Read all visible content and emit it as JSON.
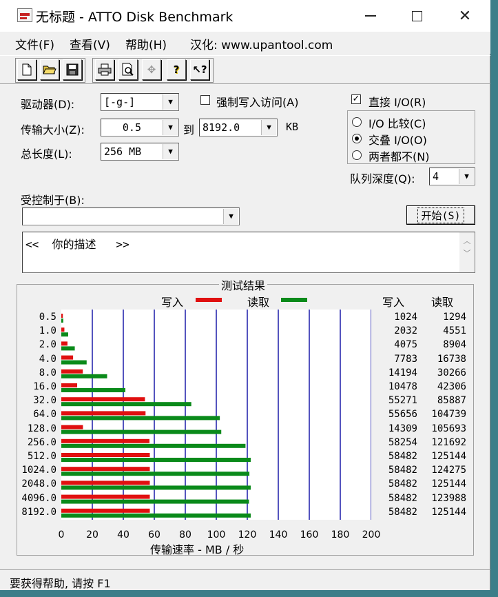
{
  "window": {
    "title": "无标题 - ATTO Disk Benchmark"
  },
  "menu": {
    "items": [
      "文件(F)",
      "查看(V)",
      "帮助(H)",
      "汉化: www.upantool.com"
    ]
  },
  "toolbar": {
    "icons": [
      "new-file-icon",
      "open-folder-icon",
      "save-icon",
      "print-icon",
      "print-preview-icon",
      "move-icon",
      "help-icon",
      "context-help-icon"
    ]
  },
  "form": {
    "drive_label": "驱动器(D):",
    "drive_value": "[-g-]",
    "transfer_label": "传输大小(Z):",
    "transfer_from": "0.5",
    "to_label": "到",
    "transfer_to": "8192.0",
    "kb_label": "KB",
    "total_label": "总长度(L):",
    "total_value": "256 MB",
    "force_write_label": "强制写入访问(A)",
    "direct_io_label": "直接 I/O(R)",
    "direct_io_checked": true,
    "io_compare_label": "I/O 比较(C)",
    "overlap_io_label": "交叠 I/O(O)",
    "neither_label": "两者都不(N)",
    "queue_label": "队列深度(Q):",
    "queue_value": "4",
    "controlled_label": "受控制于(B):",
    "controlled_value": "",
    "start_label": "开始(S)",
    "description": "<<  你的描述   >>"
  },
  "results": {
    "title": "测试结果",
    "write_legend": "写入",
    "read_legend": "读取",
    "write_col": "写入",
    "read_col": "读取",
    "write_color": "#e01010",
    "read_color": "#0a8a1a",
    "grid_color": "#1a1aa8"
  },
  "chart_data": {
    "type": "bar",
    "orientation": "horizontal",
    "categories": [
      "0.5",
      "1.0",
      "2.0",
      "4.0",
      "8.0",
      "16.0",
      "32.0",
      "64.0",
      "128.0",
      "256.0",
      "512.0",
      "1024.0",
      "2048.0",
      "4096.0",
      "8192.0"
    ],
    "series": [
      {
        "name": "写入",
        "values": [
          1024,
          2032,
          4075,
          7783,
          14194,
          10478,
          55271,
          55656,
          14309,
          58254,
          58482,
          58482,
          58482,
          58482,
          58482
        ]
      },
      {
        "name": "读取",
        "values": [
          1294,
          4551,
          8904,
          16738,
          30266,
          42306,
          85887,
          104739,
          105693,
          121692,
          125144,
          124275,
          125144,
          123988,
          125144
        ]
      }
    ],
    "xticks": [
      "0",
      "20",
      "40",
      "60",
      "80",
      "100",
      "120",
      "140",
      "160",
      "180",
      "200"
    ],
    "xlim": [
      0,
      200
    ],
    "xlabel": "传输速率 - MB / 秒",
    "grid": true
  },
  "status": {
    "text": "要获得帮助, 请按 F1"
  }
}
